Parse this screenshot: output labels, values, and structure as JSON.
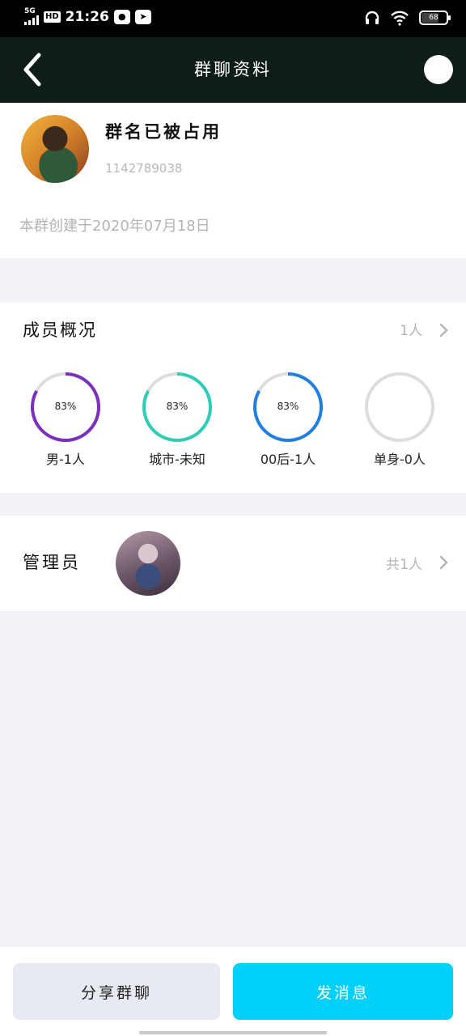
{
  "status_bar": {
    "network": "5G",
    "hd": "HD",
    "time": "21:26",
    "battery": "68"
  },
  "nav": {
    "title": "群聊资料"
  },
  "group": {
    "name": "群名已被占用",
    "id": "1142789038",
    "created": "本群创建于2020年07月18日"
  },
  "members": {
    "title": "成员概况",
    "count": "1人",
    "stats": [
      {
        "label": "男-1人",
        "percent": "83%",
        "progress": 0.83,
        "color": "#7b2fbe"
      },
      {
        "label": "城市-未知",
        "percent": "83%",
        "progress": 0.83,
        "color": "#2ecdb8"
      },
      {
        "label": "00后-1人",
        "percent": "83%",
        "progress": 0.83,
        "color": "#2080e0"
      },
      {
        "label": "单身-0人",
        "percent": "",
        "progress": 0,
        "color": "#dddddd"
      }
    ]
  },
  "admin": {
    "title": "管理员",
    "count": "共1人"
  },
  "actions": {
    "share": "分享群聊",
    "send": "发消息"
  }
}
